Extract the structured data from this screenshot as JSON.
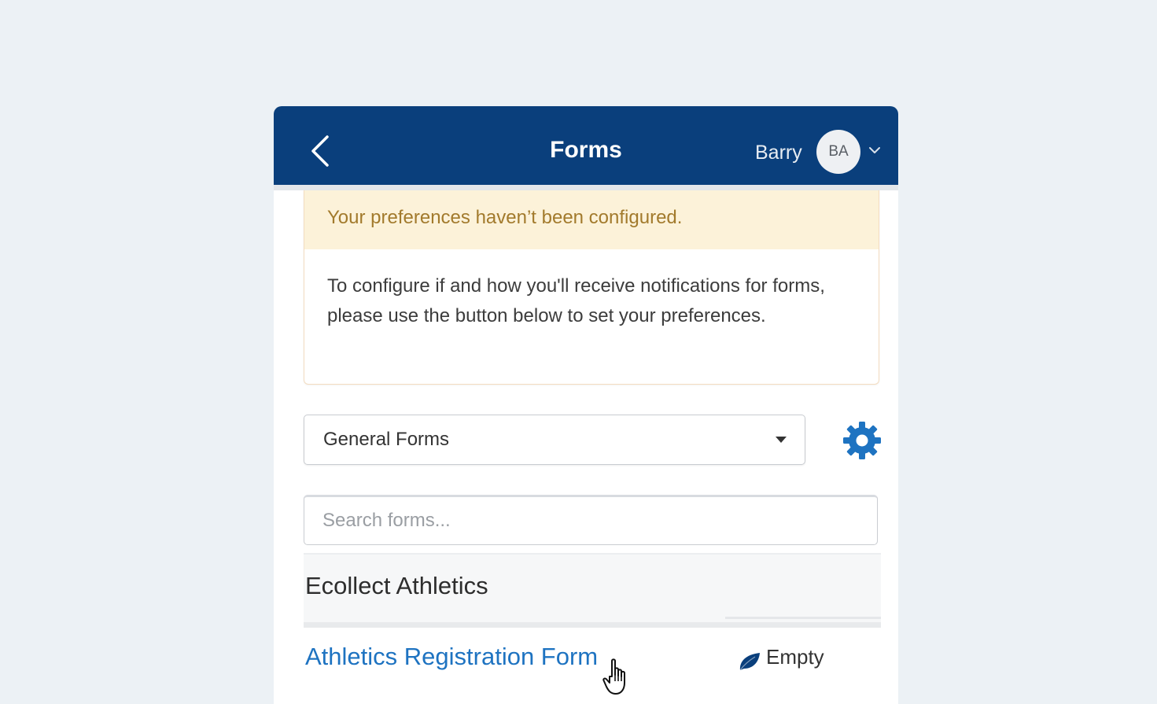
{
  "header": {
    "back_icon": "chevron-left-icon",
    "title": "Forms",
    "user_name": "Barry",
    "avatar_initials": "BA",
    "user_menu_icon": "chevron-down-icon",
    "background_color": "#0a3f7c"
  },
  "alert": {
    "title": "Your preferences haven’t been configured.",
    "body": "To configure if and how you'll receive notifications for forms, please use the button below to set your preferences.",
    "background_color": "#fcf2d9",
    "title_color": "#a27a2c"
  },
  "filter": {
    "selected": "General Forms",
    "caret_icon": "caret-down-icon",
    "settings_icon": "gear-icon",
    "accent_color": "#1e73c1"
  },
  "search": {
    "placeholder": "Search forms...",
    "value": ""
  },
  "section": {
    "title": "Ecollect Athletics",
    "items": [
      {
        "name": "Athletics Registration Form",
        "status": "Empty",
        "status_icon": "leaf-icon"
      }
    ]
  },
  "cursor": {
    "icon": "hand-pointer-icon"
  }
}
